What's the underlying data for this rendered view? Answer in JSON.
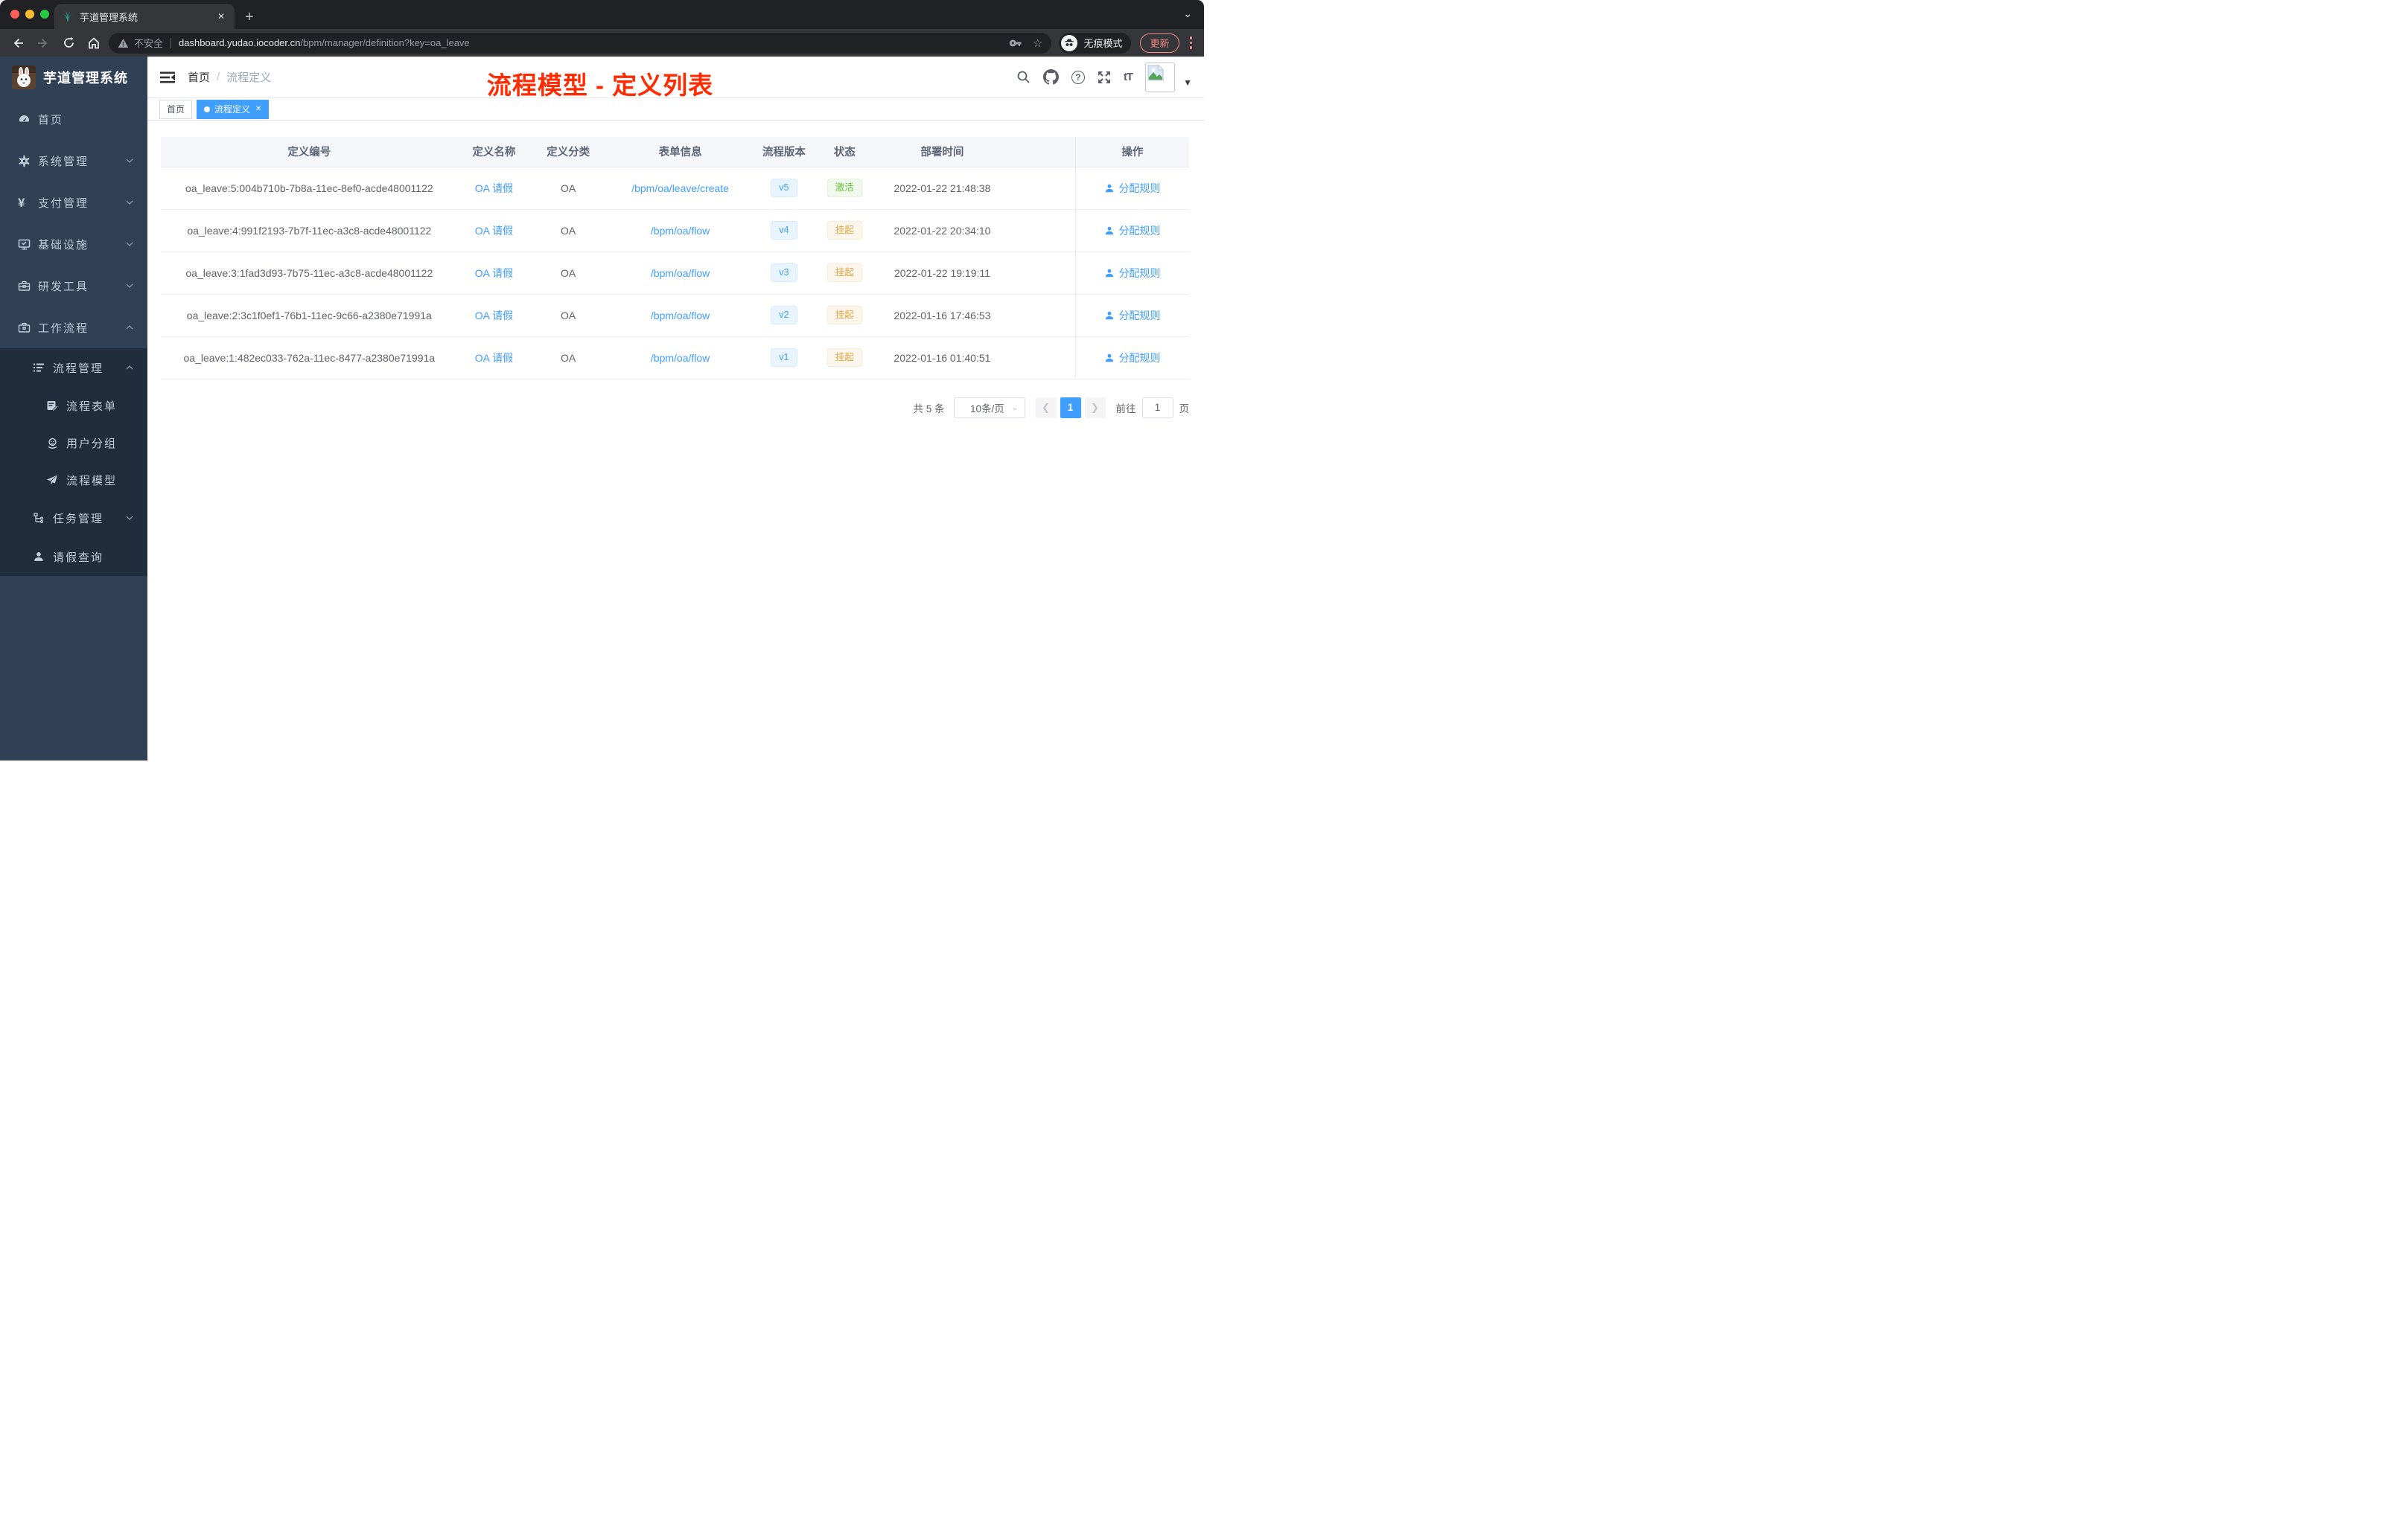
{
  "colors": {
    "accent": "#409eff",
    "sidebar_bg": "#304156",
    "submenu_bg": "#1f2d3d",
    "annotation_red": "#ff2b00",
    "chrome_dark": "#202124",
    "tag_success": "#67c23a",
    "tag_warning": "#e6a23c"
  },
  "browser": {
    "tab_title": "芋道管理系统",
    "security_label": "不安全",
    "url_domain": "dashboard.yudao.iocoder.cn",
    "url_path": "/bpm/manager/definition?key=oa_leave",
    "incognito_label": "无痕模式",
    "update_label": "更新",
    "glyphs": {
      "close": "✕",
      "plus": "+",
      "caret": "⌄",
      "star": "☆"
    }
  },
  "sidebar": {
    "logo_title": "芋道管理系统",
    "yen_glyph": "¥",
    "items": [
      {
        "label": "首页",
        "icon": "dashboard-icon"
      },
      {
        "label": "系统管理",
        "icon": "gear-icon",
        "arrow": "down"
      },
      {
        "label": "支付管理",
        "icon": "yen-icon",
        "arrow": "down"
      },
      {
        "label": "基础设施",
        "icon": "monitor-icon",
        "arrow": "down"
      },
      {
        "label": "研发工具",
        "icon": "toolbox-icon",
        "arrow": "down"
      },
      {
        "label": "工作流程",
        "icon": "briefcase-icon",
        "arrow": "up"
      },
      {
        "label": "流程管理",
        "icon": "list-icon",
        "arrow": "up"
      },
      {
        "label": "流程表单",
        "icon": "form-icon"
      },
      {
        "label": "用户分组",
        "icon": "people-icon"
      },
      {
        "label": "流程模型",
        "icon": "paper-plane-icon"
      },
      {
        "label": "任务管理",
        "icon": "tree-icon",
        "arrow": "down"
      },
      {
        "label": "请假查询",
        "icon": "person-icon"
      }
    ]
  },
  "navbar": {
    "breadcrumb": {
      "home": "首页",
      "separator": "/",
      "current": "流程定义"
    },
    "annotation": "流程模型 - 定义列表",
    "question_glyph": "?",
    "font_size_glyph": "tT"
  },
  "tags_view": {
    "tabs": [
      {
        "label": "首页",
        "active": false
      },
      {
        "label": "流程定义",
        "active": true,
        "close": "✕"
      }
    ]
  },
  "table": {
    "headers": [
      "定义编号",
      "定义名称",
      "定义分类",
      "表单信息",
      "流程版本",
      "状态",
      "部署时间",
      "操作"
    ],
    "rows": [
      {
        "id": "oa_leave:5:004b710b-7b8a-11ec-8ef0-acde48001122",
        "name": "OA 请假",
        "category": "OA",
        "form": "/bpm/oa/leave/create",
        "version": "v5",
        "status": "激活",
        "status_type": "success",
        "deployed": "2022-01-22 21:48:38",
        "action": "分配规则"
      },
      {
        "id": "oa_leave:4:991f2193-7b7f-11ec-a3c8-acde48001122",
        "name": "OA 请假",
        "category": "OA",
        "form": "/bpm/oa/flow",
        "version": "v4",
        "status": "挂起",
        "status_type": "warning",
        "deployed": "2022-01-22 20:34:10",
        "action": "分配规则"
      },
      {
        "id": "oa_leave:3:1fad3d93-7b75-11ec-a3c8-acde48001122",
        "name": "OA 请假",
        "category": "OA",
        "form": "/bpm/oa/flow",
        "version": "v3",
        "status": "挂起",
        "status_type": "warning",
        "deployed": "2022-01-22 19:19:11",
        "action": "分配规则"
      },
      {
        "id": "oa_leave:2:3c1f0ef1-76b1-11ec-9c66-a2380e71991a",
        "name": "OA 请假",
        "category": "OA",
        "form": "/bpm/oa/flow",
        "version": "v2",
        "status": "挂起",
        "status_type": "warning",
        "deployed": "2022-01-16 17:46:53",
        "action": "分配规则"
      },
      {
        "id": "oa_leave:1:482ec033-762a-11ec-8477-a2380e71991a",
        "name": "OA 请假",
        "category": "OA",
        "form": "/bpm/oa/flow",
        "version": "v1",
        "status": "挂起",
        "status_type": "warning",
        "deployed": "2022-01-16 01:40:51",
        "action": "分配规则"
      }
    ]
  },
  "pagination": {
    "total": "共 5 条",
    "page_size": "10条/页",
    "current_page": "1",
    "goto_label": "前往",
    "goto_value": "1",
    "page_suffix": "页"
  }
}
